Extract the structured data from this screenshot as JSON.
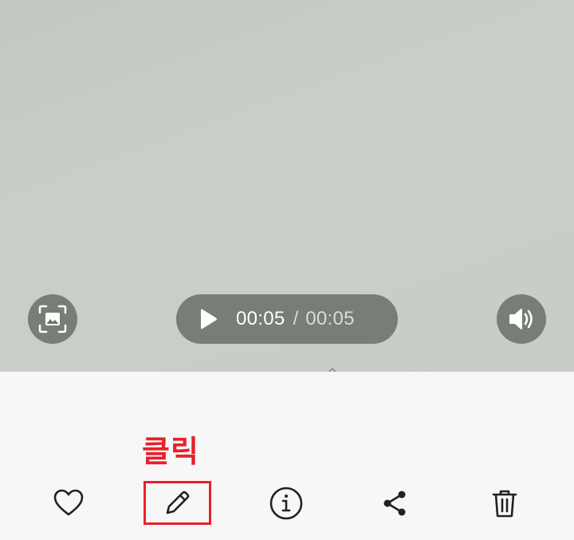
{
  "player": {
    "current_time": "00:05",
    "separator": "/",
    "total_time": "00:05",
    "play_icon": "play-icon",
    "capture_icon": "image-capture-icon",
    "volume_icon": "speaker-icon"
  },
  "annotation": {
    "label": "클릭",
    "color": "#e8202a"
  },
  "toolbar": {
    "items": [
      {
        "name": "favorite",
        "icon": "heart-icon"
      },
      {
        "name": "edit",
        "icon": "pencil-icon"
      },
      {
        "name": "details",
        "icon": "info-icon"
      },
      {
        "name": "share",
        "icon": "share-icon"
      },
      {
        "name": "delete",
        "icon": "trash-icon"
      }
    ]
  }
}
